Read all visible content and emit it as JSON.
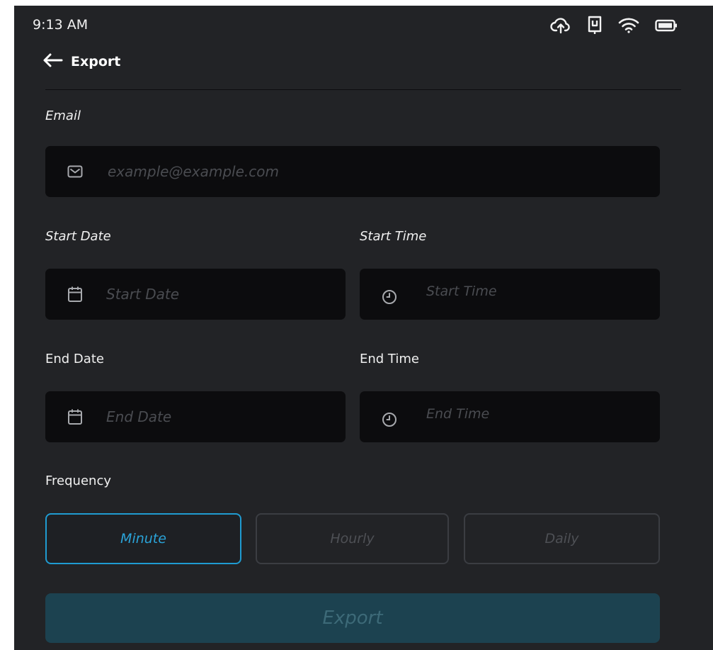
{
  "status_bar": {
    "time": "9:13 AM",
    "icons": [
      "cloud-upload-icon",
      "device-icon",
      "wifi-icon",
      "battery-icon"
    ]
  },
  "header": {
    "title": "Export",
    "back_icon": "arrow-left-icon"
  },
  "email": {
    "label": "Email",
    "placeholder": "example@example.com",
    "icon": "mail-icon"
  },
  "start_date": {
    "label": "Start Date",
    "placeholder": "Start Date",
    "icon": "calendar-icon"
  },
  "start_time": {
    "label": "Start Time",
    "placeholder": "Start Time",
    "icon": "clock-icon"
  },
  "end_date": {
    "label": "End Date",
    "placeholder": "End Date",
    "icon": "calendar-icon"
  },
  "end_time": {
    "label": "End Time",
    "placeholder": "End Time",
    "icon": "clock-icon"
  },
  "frequency": {
    "label": "Frequency",
    "options": [
      "Minute",
      "Hourly",
      "Daily"
    ],
    "selected": "Minute"
  },
  "export_button": {
    "label": "Export"
  },
  "colors": {
    "background": "#222326",
    "field": "#0c0c0e",
    "accent": "#1f9bd1",
    "export_button": "#1c4250"
  }
}
